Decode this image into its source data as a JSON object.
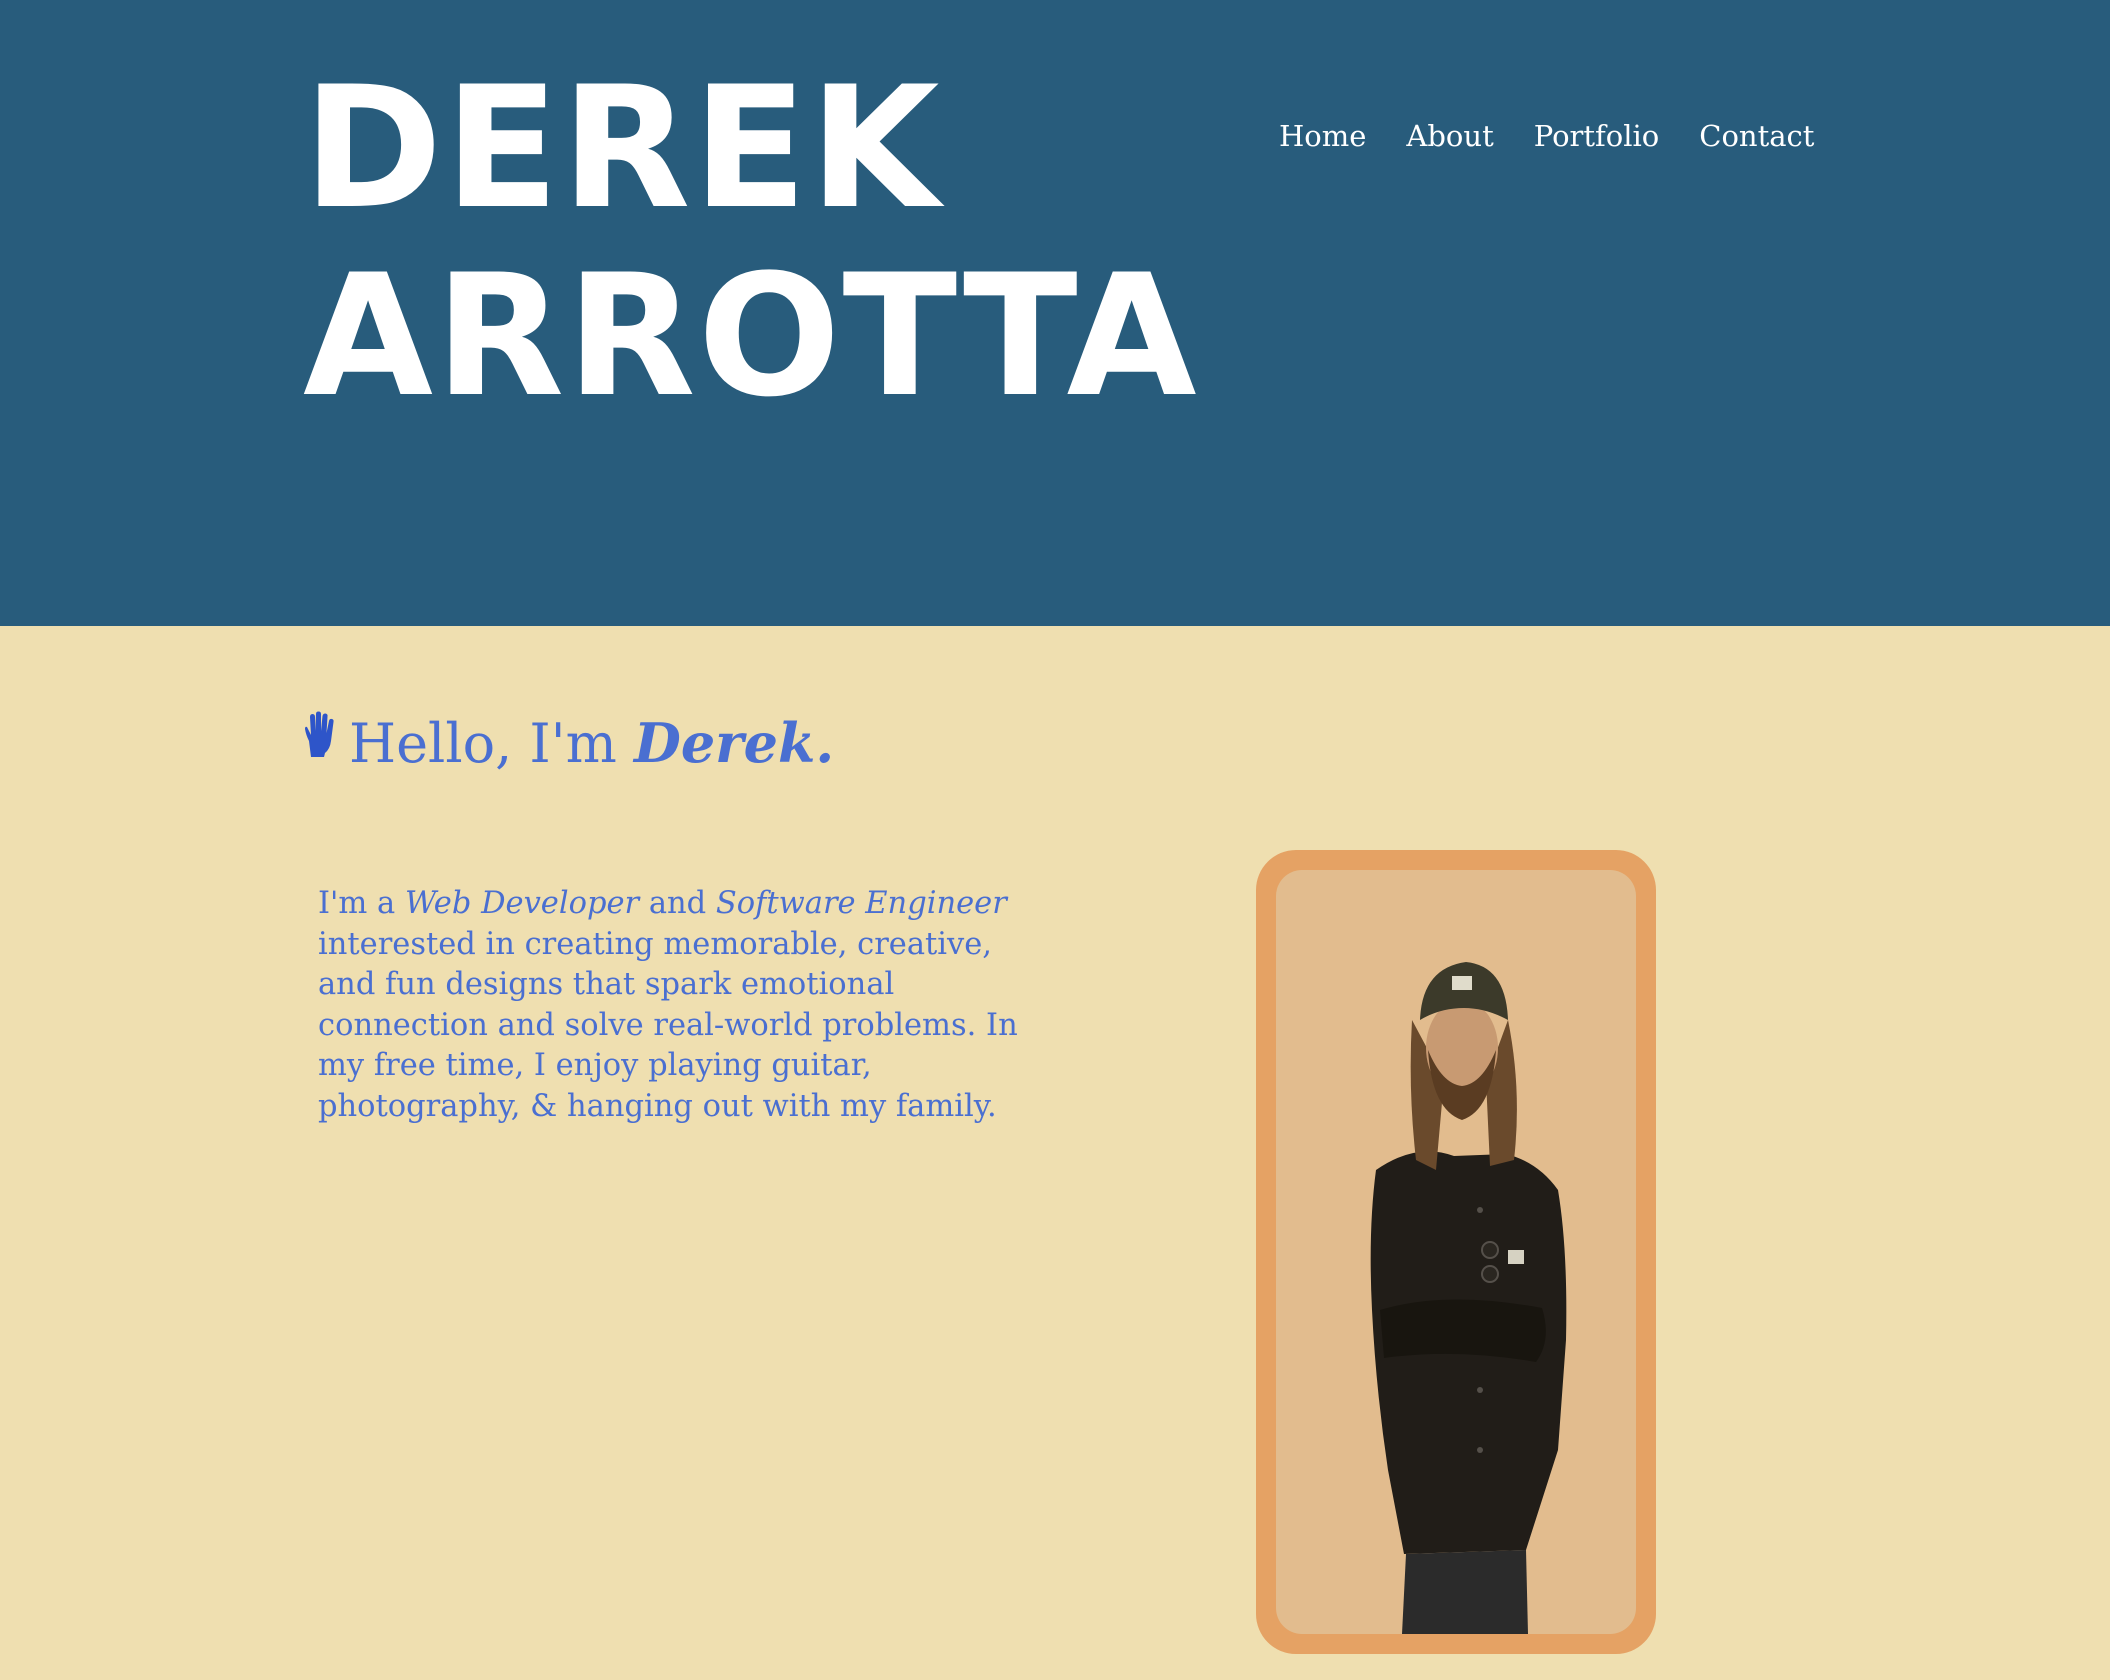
{
  "header": {
    "logo_line1": "DEREK",
    "logo_line2": "ARROTTA",
    "nav": [
      {
        "label": "Home"
      },
      {
        "label": "About"
      },
      {
        "label": "Portfolio"
      },
      {
        "label": "Contact"
      }
    ]
  },
  "hero": {
    "greeting_prefix": "Hello, I'm ",
    "greeting_name": "Derek.",
    "hand_icon": "raised-hand-icon",
    "intro": {
      "part1": "I'm a ",
      "role1": "Web Developer",
      "part2": " and ",
      "role2": "Software Engineer",
      "part3": " interested in creating memorable, creative, and fun designs that spark emotional connection and solve real-world problems. In my free time, I enjoy playing guitar, photography, & hanging out with my family."
    }
  },
  "colors": {
    "header_bg": "#285c7c",
    "page_bg": "#efdfb0",
    "accent_text": "#4a6fd1",
    "frame": "#e5a264",
    "frame_inner": "#e2bc8e"
  }
}
